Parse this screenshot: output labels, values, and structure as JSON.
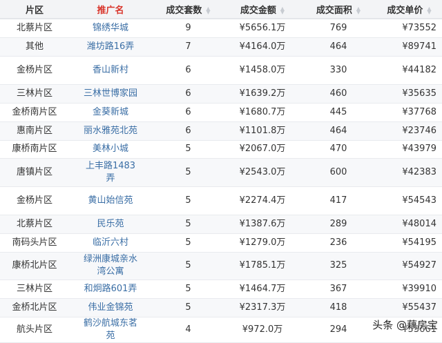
{
  "headers": {
    "district": "片区",
    "name": "推广名",
    "count": "成交套数",
    "amount": "成交金额",
    "area": "成交面积",
    "price": "成交单价"
  },
  "rows": [
    {
      "district": "北蔡片区",
      "name": "锦绣华城",
      "count": "9",
      "amount": "¥5656.1万",
      "area": "769",
      "price": "¥73552",
      "h": 27
    },
    {
      "district": "其他",
      "name": "潍坊路16弄",
      "count": "7",
      "amount": "¥4164.0万",
      "area": "464",
      "price": "¥89741",
      "h": 27
    },
    {
      "district": "金杨片区",
      "name": "香山新村",
      "count": "6",
      "amount": "¥1458.0万",
      "area": "330",
      "price": "¥44182",
      "h": 41
    },
    {
      "district": "三林片区",
      "name": "三林世博家园",
      "count": "6",
      "amount": "¥1639.2万",
      "area": "460",
      "price": "¥35635",
      "h": 27
    },
    {
      "district": "金桥南片区",
      "name": "金葵新城",
      "count": "6",
      "amount": "¥1680.7万",
      "area": "445",
      "price": "¥37768",
      "h": 27
    },
    {
      "district": "惠南片区",
      "name": "丽水雅苑北苑",
      "count": "6",
      "amount": "¥1101.8万",
      "area": "464",
      "price": "¥23746",
      "h": 27
    },
    {
      "district": "康桥南片区",
      "name": "美林小城",
      "count": "5",
      "amount": "¥2067.0万",
      "area": "470",
      "price": "¥43979",
      "h": 26
    },
    {
      "district": "唐镇片区",
      "name": "上丰路1483弄",
      "count": "5",
      "amount": "¥2543.0万",
      "area": "600",
      "price": "¥42383",
      "h": 41
    },
    {
      "district": "金杨片区",
      "name": "黄山始信苑",
      "count": "5",
      "amount": "¥2274.4万",
      "area": "417",
      "price": "¥54543",
      "h": 41
    },
    {
      "district": "北蔡片区",
      "name": "民乐苑",
      "count": "5",
      "amount": "¥1387.6万",
      "area": "289",
      "price": "¥48014",
      "h": 27
    },
    {
      "district": "南码头片区",
      "name": "临沂六村",
      "count": "5",
      "amount": "¥1279.0万",
      "area": "236",
      "price": "¥54195",
      "h": 27
    },
    {
      "district": "康桥北片区",
      "name": "绿洲康城亲水湾公寓",
      "count": "5",
      "amount": "¥1785.1万",
      "area": "325",
      "price": "¥54927",
      "h": 40
    },
    {
      "district": "三林片区",
      "name": "和炯路601弄",
      "count": "5",
      "amount": "¥1464.7万",
      "area": "367",
      "price": "¥39910",
      "h": 27
    },
    {
      "district": "金桥北片区",
      "name": "伟业金锦苑",
      "count": "5",
      "amount": "¥2317.3万",
      "area": "418",
      "price": "¥55437",
      "h": 27
    },
    {
      "district": "航头片区",
      "name": "鹤沙航城东茗苑",
      "count": "4",
      "amount": "¥972.0万",
      "area": "294",
      "price": "¥53661",
      "h": 27
    }
  ],
  "watermark": "头条 @藕房宝"
}
